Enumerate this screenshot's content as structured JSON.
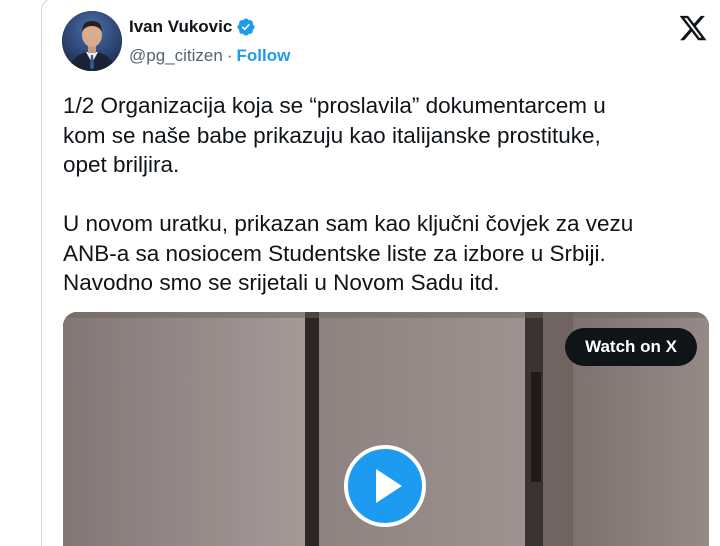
{
  "author": {
    "display_name": "Ivan Vukovic",
    "handle": "@pg_citizen",
    "separator": "·",
    "follow_label": "Follow",
    "verified": true
  },
  "tweet": {
    "paragraphs": [
      "1/2 Organizacija koja se “proslavila” dokumentarcem u\nkom se naše babe prikazuju kao italijanske prostituke,\nopet briljira.",
      "U novom uratku, prikazan sam kao ključni čovjek za vezu\nANB-a sa nosiocem Studentske liste za izbore u Srbiji.\nNavodno smo se srijetali u Novom Sadu itd."
    ]
  },
  "media": {
    "watch_label": "Watch on X"
  },
  "icons": {
    "brand_logo": "x-logo-icon",
    "verified": "verified-badge-icon",
    "play": "play-icon"
  },
  "colors": {
    "accent": "#1d9bf0",
    "text": "#0f1419",
    "muted": "#536471",
    "border": "#cfd9de"
  }
}
